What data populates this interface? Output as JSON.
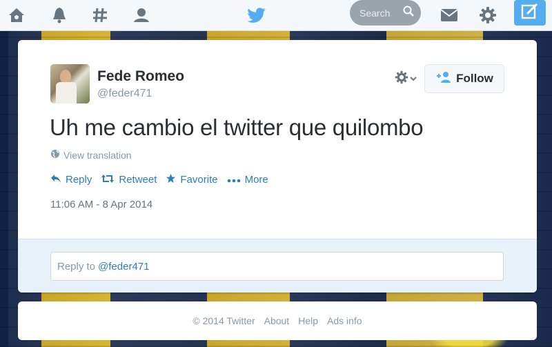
{
  "topbar": {
    "nav_icons": [
      "home-icon",
      "notifications-icon",
      "discover-icon",
      "profile-icon"
    ],
    "center_icon": "twitter-bird-logo",
    "search": {
      "placeholder": "Search",
      "icon": "search-icon"
    },
    "right_icons": [
      "messages-icon",
      "settings-icon",
      "compose-icon"
    ]
  },
  "tweet": {
    "fullname": "Fede Romeo",
    "username": "@feder471",
    "text": "Uh me cambio el twitter que quilombo",
    "translate_label": "View translation",
    "follow_label": "Follow",
    "actions": [
      {
        "label": "Reply",
        "icon": "reply-icon"
      },
      {
        "label": "Retweet",
        "icon": "retweet-icon"
      },
      {
        "label": "Favorite",
        "icon": "star-icon"
      },
      {
        "label": "More",
        "icon": "more-icon"
      }
    ],
    "timestamp": "11:06 AM - 8 Apr 2014",
    "reply_prefix": "Reply to",
    "reply_handle": "@feder471"
  },
  "footer": {
    "copyright": "© 2014 Twitter",
    "links": [
      "About",
      "Help",
      "Ads info"
    ]
  },
  "colors": {
    "accent": "#55acee",
    "link": "#2f7db6",
    "nav_icon": "#66757f"
  }
}
